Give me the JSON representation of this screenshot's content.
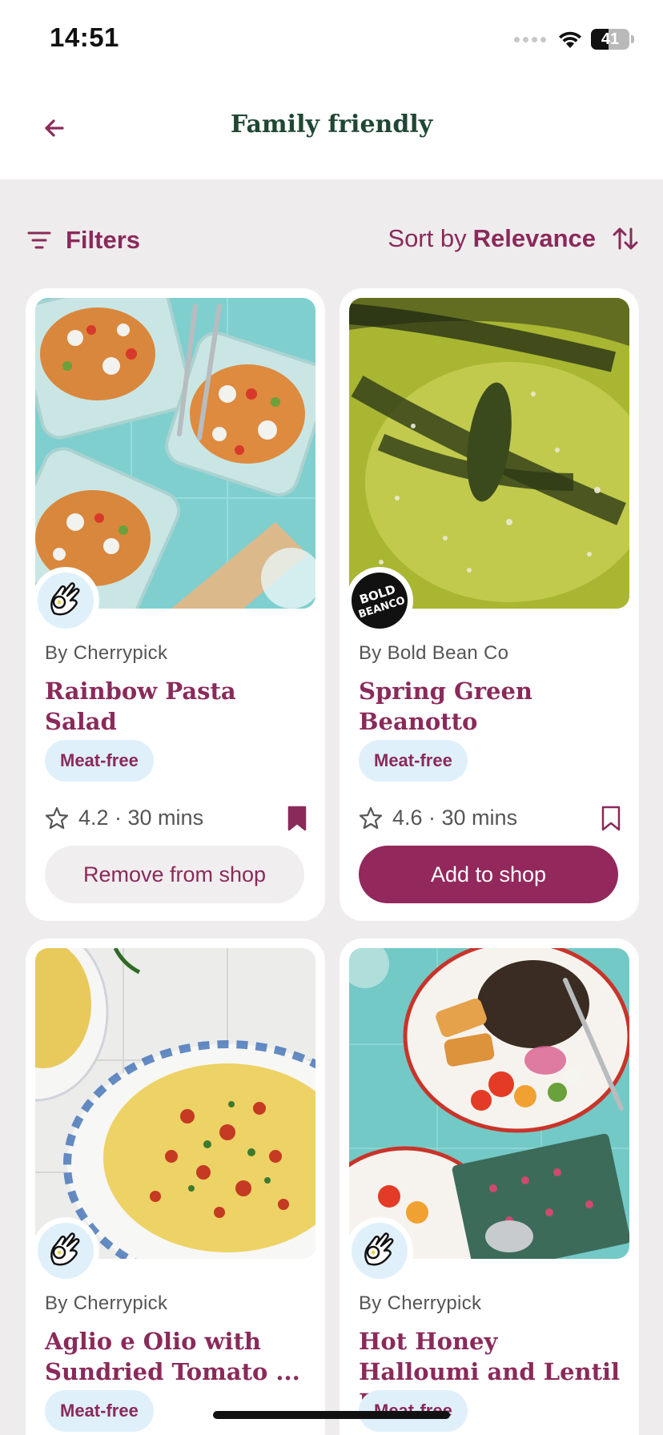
{
  "status_bar": {
    "time": "14:51",
    "battery": "41"
  },
  "header": {
    "title": "Family friendly"
  },
  "filter_bar": {
    "filters_label": "Filters",
    "sort_prefix": "Sort by",
    "sort_value": "Relevance"
  },
  "recipes": [
    {
      "author": "By Cherrypick",
      "title": "Rainbow Pasta Salad",
      "tag": "Meat-free",
      "rating": "4.2 · 30 mins",
      "saved": true,
      "shop_button": "Remove from shop"
    },
    {
      "author": "By Bold Bean Co",
      "title": "Spring Green Beanotto",
      "tag": "Meat-free",
      "rating": "4.6 · 30 mins",
      "saved": false,
      "shop_button": "Add to shop"
    },
    {
      "author": "By Cherrypick",
      "title": "Aglio e Olio with Sundried Tomato ...",
      "tag": "Meat-free"
    },
    {
      "author": "By Cherrypick",
      "title": "Hot Honey Halloumi and Lentil Bowl",
      "tag": "Meat-free"
    }
  ],
  "brand_logos": {
    "bold_bean_logo_text": "BOLD BEANCO"
  },
  "colors": {
    "brand": "#8a2a5a",
    "button_primary": "#93285c",
    "title_green": "#1f4733",
    "tag_bg": "#dff0fb",
    "page_bg": "#efeced"
  }
}
